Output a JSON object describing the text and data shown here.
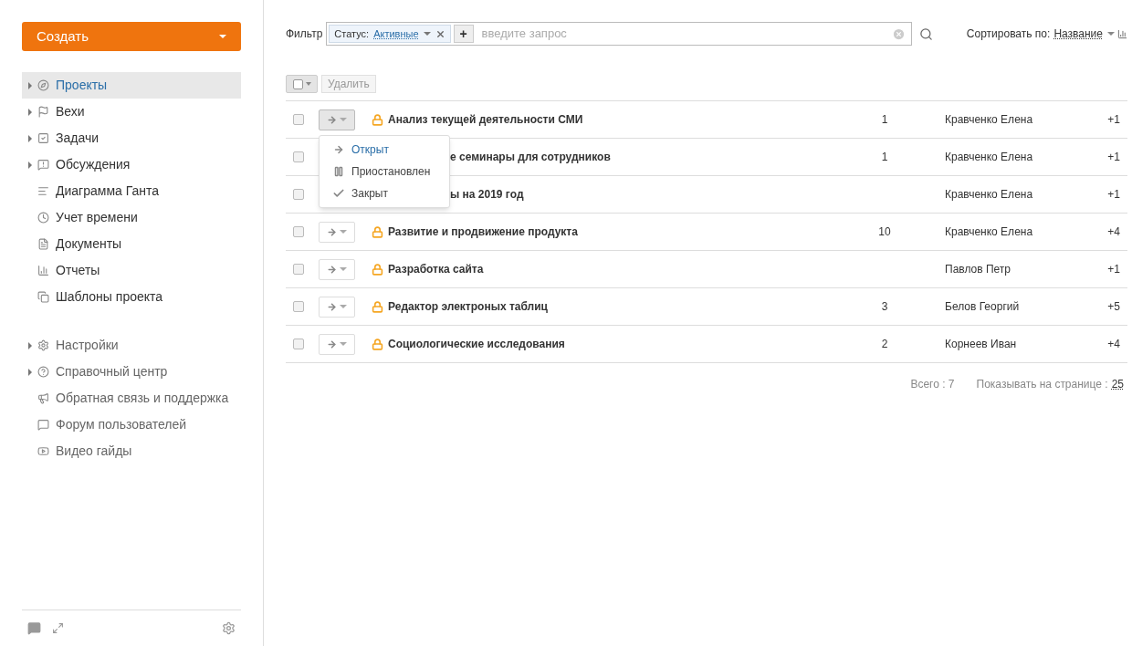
{
  "sidebar": {
    "create_button": "Создать",
    "items": [
      {
        "label": "Проекты",
        "expandable": true,
        "selected": true
      },
      {
        "label": "Вехи",
        "expandable": true,
        "selected": false
      },
      {
        "label": "Задачи",
        "expandable": true,
        "selected": false
      },
      {
        "label": "Обсуждения",
        "expandable": true,
        "selected": false
      },
      {
        "label": "Диаграмма Ганта",
        "expandable": false,
        "selected": false
      },
      {
        "label": "Учет времени",
        "expandable": false,
        "selected": false
      },
      {
        "label": "Документы",
        "expandable": false,
        "selected": false
      },
      {
        "label": "Отчеты",
        "expandable": false,
        "selected": false
      },
      {
        "label": "Шаблоны проекта",
        "expandable": false,
        "selected": false
      }
    ],
    "secondary_items": [
      {
        "label": "Настройки",
        "expandable": true
      },
      {
        "label": "Справочный центр",
        "expandable": true
      },
      {
        "label": "Обратная связь и поддержка",
        "expandable": false
      },
      {
        "label": "Форум пользователей",
        "expandable": false
      },
      {
        "label": "Видео гайды",
        "expandable": false
      }
    ]
  },
  "filter": {
    "label": "Фильтр",
    "chip_key": "Статус:",
    "chip_value": "Активные",
    "placeholder": "введите запрос",
    "add_button": "+"
  },
  "sort": {
    "label": "Сортировать по:",
    "value": "Название"
  },
  "toolbar": {
    "delete_button": "Удалить"
  },
  "rows": [
    {
      "title": "Анализ текущей деятельности СМИ",
      "locked": true,
      "covered": false,
      "menu_open": true,
      "checked": false,
      "count": "1",
      "manager": "Кравченко Елена",
      "team": "+1"
    },
    {
      "title": "е семинары для сотрудников",
      "covered": true,
      "menu_open": false,
      "checked": false,
      "count": "1",
      "manager": "Кравченко Елена",
      "team": "+1"
    },
    {
      "title": "ы на 2019 год",
      "covered": true,
      "menu_open": false,
      "checked": false,
      "count": "",
      "manager": "Кравченко Елена",
      "team": "+1"
    },
    {
      "title": "Развитие и продвижение продукта",
      "locked": true,
      "covered": false,
      "menu_open": false,
      "checked": false,
      "count": "10",
      "manager": "Кравченко Елена",
      "team": "+4"
    },
    {
      "title": "Разработка сайта",
      "locked": true,
      "covered": false,
      "menu_open": false,
      "checked": false,
      "count": "",
      "manager": "Павлов Петр",
      "team": "+1"
    },
    {
      "title": "Редактор электроных таблиц",
      "locked": true,
      "covered": false,
      "menu_open": false,
      "checked": false,
      "count": "3",
      "manager": "Белов Георгий",
      "team": "+5"
    },
    {
      "title": "Социологические исследования",
      "locked": true,
      "covered": false,
      "menu_open": false,
      "checked": false,
      "count": "2",
      "manager": "Корнеев Иван",
      "team": "+4"
    }
  ],
  "status_menu": [
    {
      "kind": "open",
      "label": "Открыт",
      "selected": true
    },
    {
      "kind": "paused",
      "label": "Приостановлен",
      "selected": false
    },
    {
      "kind": "closed",
      "label": "Закрыт",
      "selected": false
    }
  ],
  "footer": {
    "total": "Всего : 7",
    "per_page_label": "Показывать на странице :",
    "per_page": "25"
  }
}
